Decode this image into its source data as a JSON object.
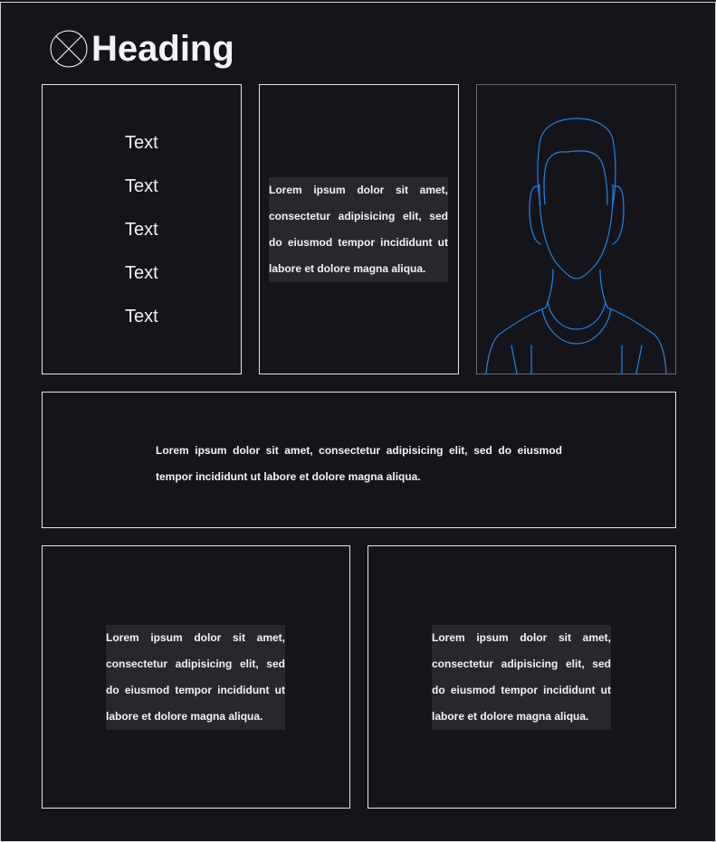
{
  "header": {
    "title": "Heading",
    "logo_icon": "placeholder-x-circle-icon"
  },
  "list_card": {
    "items": [
      "Text",
      "Text",
      "Text",
      "Text",
      "Text"
    ]
  },
  "paragraph_card": {
    "text": "Lorem ipsum dolor sit amet, consectetur adipisicing elit, sed do eiusmod tempor incididunt ut labore et dolore magna aliqua."
  },
  "avatar_card": {
    "icon": "person-silhouette-icon",
    "stroke_color": "#1f86e6"
  },
  "wide_card": {
    "text": "Lorem ipsum dolor sit amet, consectetur adipisicing elit, sed do eiusmod tempor incididunt ut labore et dolore magna aliqua."
  },
  "bottom_left_card": {
    "text": "Lorem ipsum dolor sit amet, consectetur adipisicing elit, sed do eiusmod tempor incididunt ut labore et dolore magna aliqua."
  },
  "bottom_right_card": {
    "text": "Lorem ipsum dolor sit amet, consectetur adipisicing elit, sed do eiusmod tempor incididunt ut labore et dolore magna aliqua."
  },
  "colors": {
    "background": "#16141b",
    "border": "#e6e6ea",
    "text_panel": "#29262d",
    "accent": "#1f86e6"
  }
}
